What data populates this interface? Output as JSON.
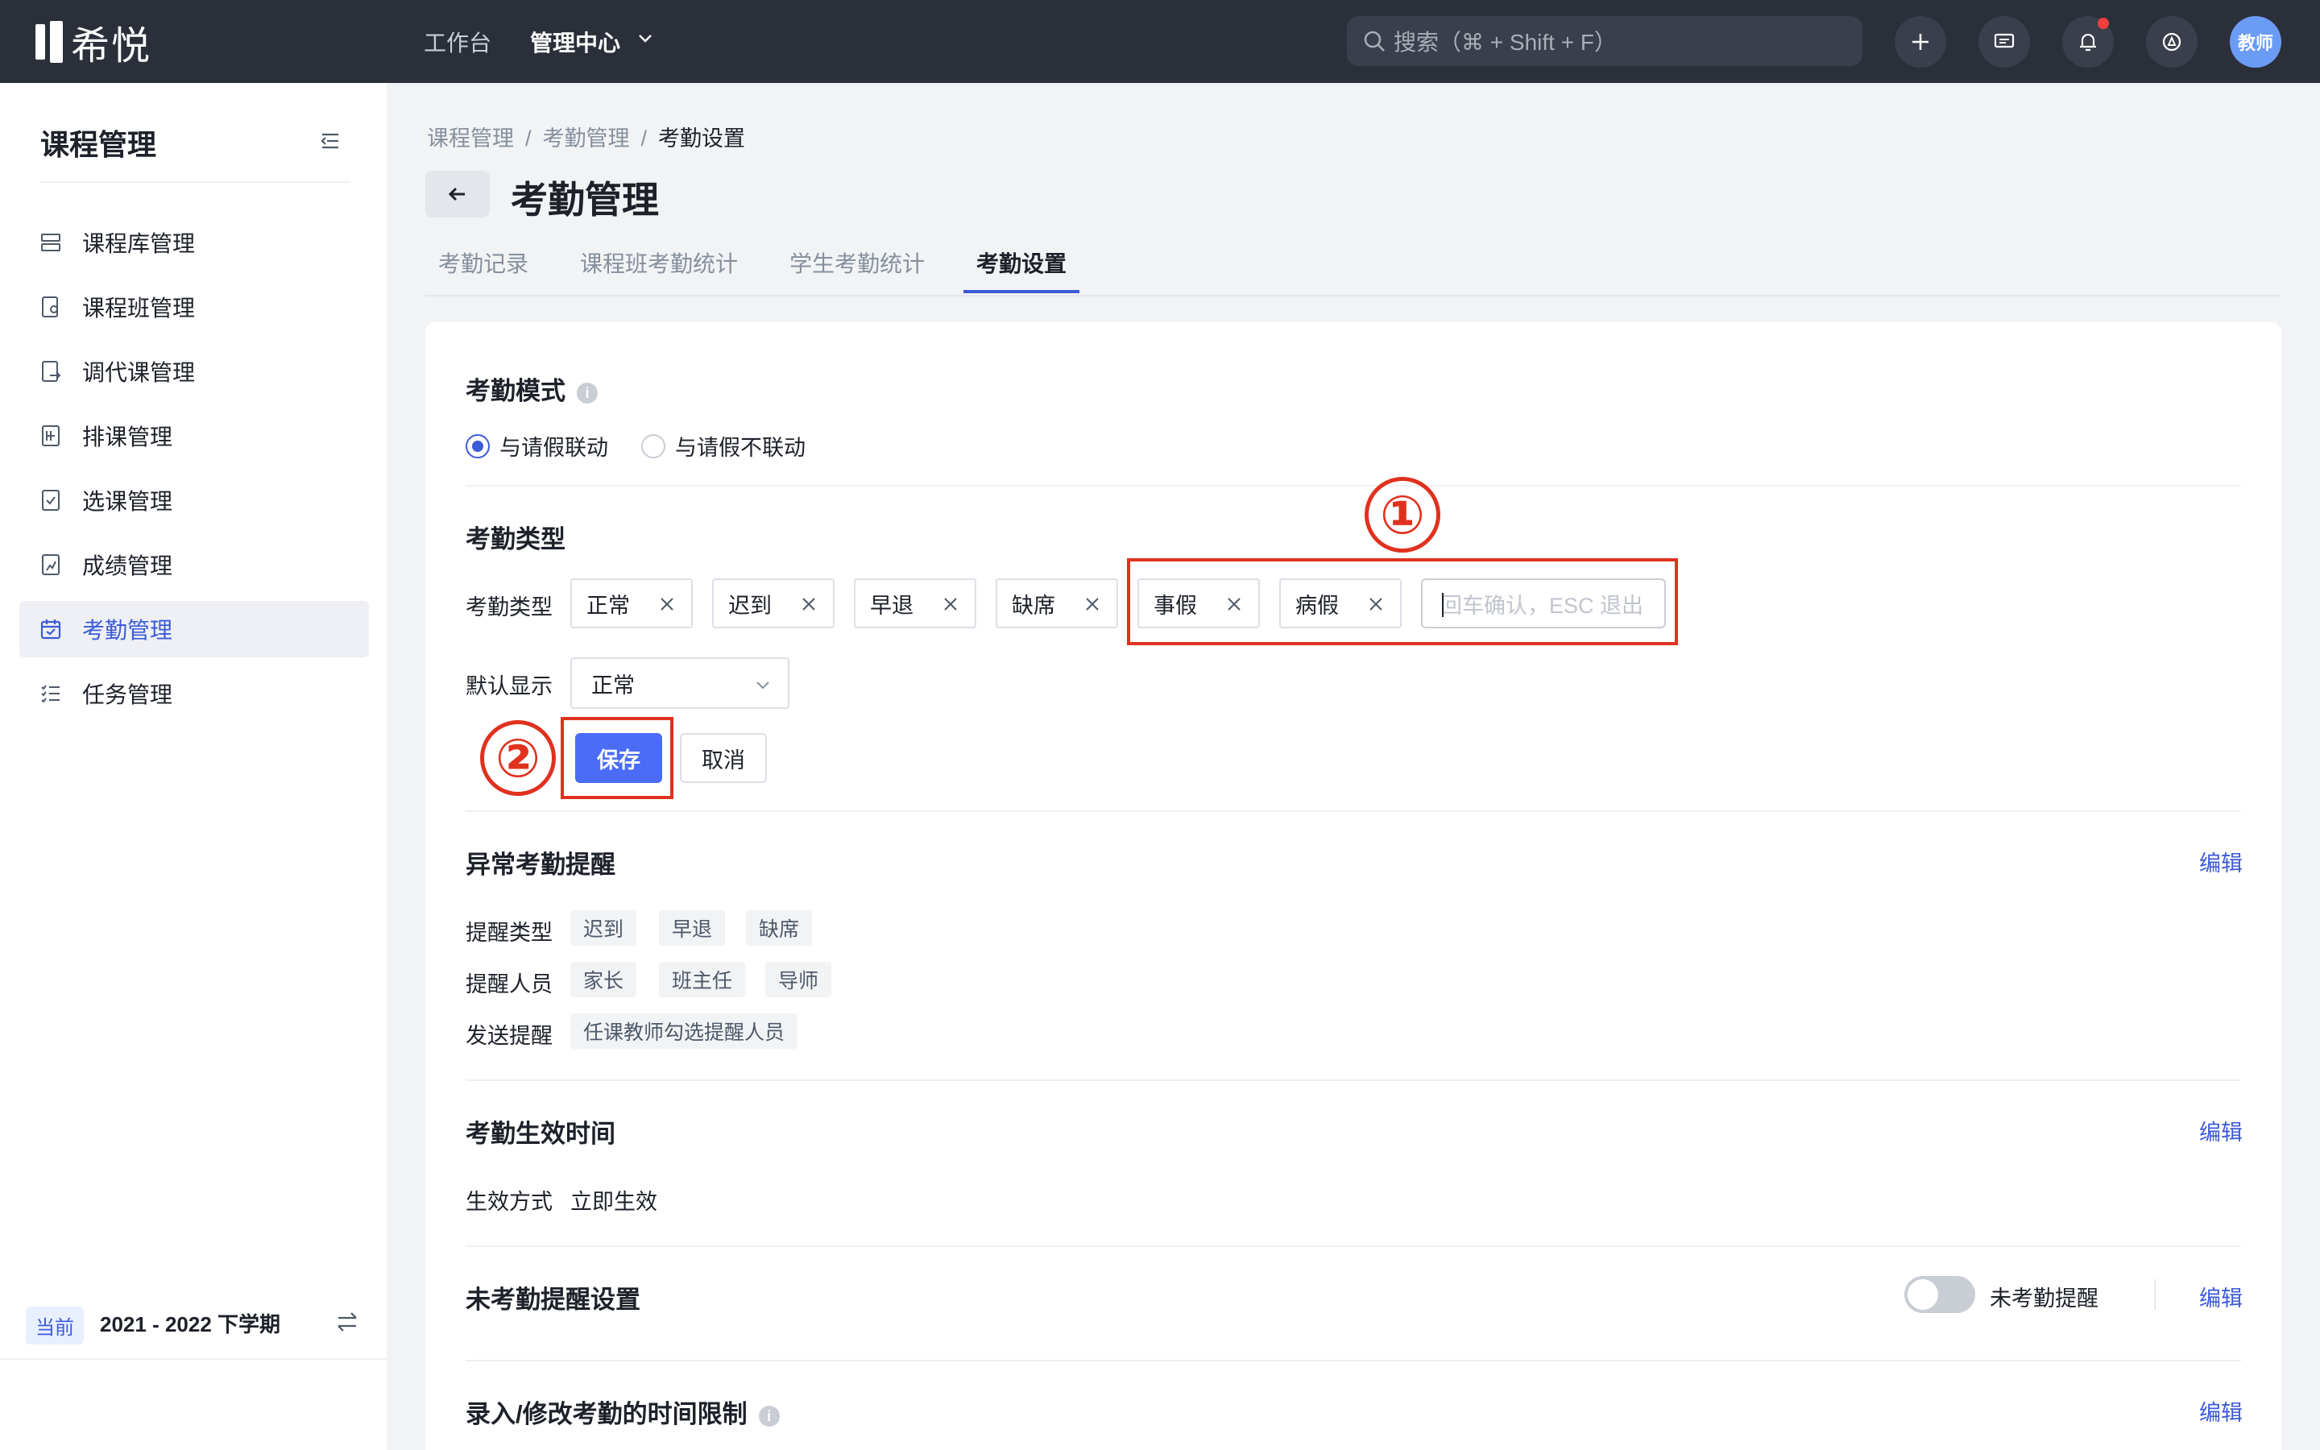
{
  "topbar": {
    "logo_text": "希悦",
    "nav": [
      "工作台",
      "管理中心"
    ],
    "search_placeholder": "搜索（⌘ + Shift + F）",
    "avatar_text": "教师"
  },
  "sidebar": {
    "title": "课程管理",
    "items": [
      {
        "label": "课程库管理",
        "icon": "stack-icon"
      },
      {
        "label": "课程班管理",
        "icon": "class-icon"
      },
      {
        "label": "调代课管理",
        "icon": "swap-icon"
      },
      {
        "label": "排课管理",
        "icon": "schedule-icon"
      },
      {
        "label": "选课管理",
        "icon": "checkbox-icon"
      },
      {
        "label": "成绩管理",
        "icon": "grade-icon"
      },
      {
        "label": "考勤管理",
        "icon": "calendar-icon"
      },
      {
        "label": "任务管理",
        "icon": "tasklist-icon"
      }
    ],
    "active_index": 6,
    "term_badge": "当前",
    "term_text": "2021 - 2022 下学期"
  },
  "breadcrumb": [
    "课程管理",
    "考勤管理",
    "考勤设置"
  ],
  "page_title": "考勤管理",
  "tabs": [
    "考勤记录",
    "课程班考勤统计",
    "学生考勤统计",
    "考勤设置"
  ],
  "active_tab": 3,
  "mode": {
    "title": "考勤模式",
    "options": [
      "与请假联动",
      "与请假不联动"
    ],
    "selected": 0
  },
  "type": {
    "title": "考勤类型",
    "label": "考勤类型",
    "tags": [
      "正常",
      "迟到",
      "早退",
      "缺席",
      "事假",
      "病假"
    ],
    "input_placeholder": "回车确认，ESC 退出",
    "default_label": "默认显示",
    "default_value": "正常",
    "save_label": "保存",
    "cancel_label": "取消"
  },
  "annotations": [
    "①",
    "②"
  ],
  "abnormal": {
    "title": "异常考勤提醒",
    "edit": "编辑",
    "rows": [
      {
        "label": "提醒类型",
        "values": [
          "迟到",
          "早退",
          "缺席"
        ]
      },
      {
        "label": "提醒人员",
        "values": [
          "家长",
          "班主任",
          "导师"
        ]
      },
      {
        "label": "发送提醒",
        "values": [
          "任课教师勾选提醒人员"
        ]
      }
    ]
  },
  "effective": {
    "title": "考勤生效时间",
    "edit": "编辑",
    "label": "生效方式",
    "value": "立即生效"
  },
  "unattended": {
    "title": "未考勤提醒设置",
    "toggle_label": "未考勤提醒",
    "toggle_on": false,
    "edit": "编辑"
  },
  "time_limit": {
    "title": "录入/修改考勤的时间限制",
    "edit": "编辑"
  },
  "colors": {
    "accent": "#3c5bd6",
    "primary_button": "#4a6cf7",
    "annotation": "#e0311f",
    "topbar": "#2b2f3a"
  }
}
